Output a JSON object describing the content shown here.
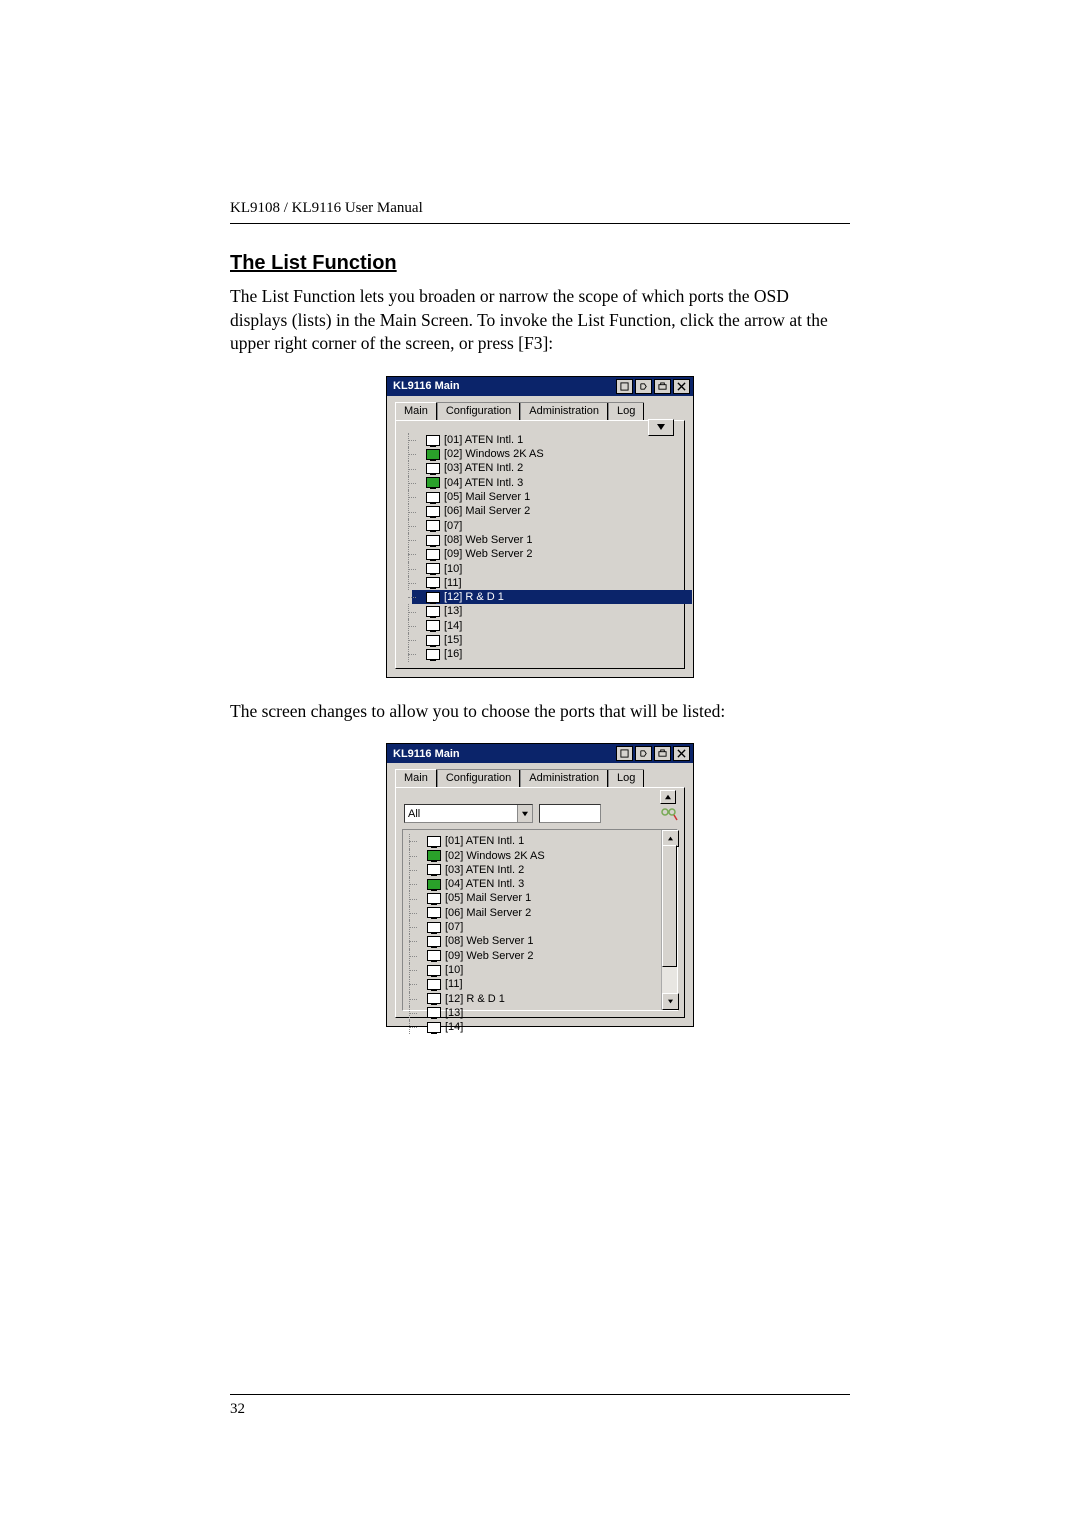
{
  "header": "KL9108 / KL9116 User Manual",
  "section_title": "The List Function",
  "paragraph1": "The List Function lets you broaden or narrow the scope of which ports the OSD displays (lists) in the Main Screen. To invoke the List Function, click the arrow at the upper right corner of the screen, or press [F3]:",
  "paragraph2": "The screen changes to allow you to choose the ports that will be listed:",
  "page_number": "32",
  "osd": {
    "title": "KL9116 Main",
    "tabs": [
      "Main",
      "Configuration",
      "Administration",
      "Log"
    ],
    "ports1": [
      {
        "num": "[01]",
        "name": "ATEN Intl. 1",
        "on": false
      },
      {
        "num": "[02]",
        "name": "Windows 2K AS",
        "on": true
      },
      {
        "num": "[03]",
        "name": "ATEN Intl. 2",
        "on": false
      },
      {
        "num": "[04]",
        "name": "ATEN Intl. 3",
        "on": true
      },
      {
        "num": "[05]",
        "name": "Mail Server 1",
        "on": false
      },
      {
        "num": "[06]",
        "name": "Mail Server 2",
        "on": false
      },
      {
        "num": "[07]",
        "name": "",
        "on": false
      },
      {
        "num": "[08]",
        "name": "Web Server 1",
        "on": false
      },
      {
        "num": "[09]",
        "name": "Web Server 2",
        "on": false
      },
      {
        "num": "[10]",
        "name": "",
        "on": false
      },
      {
        "num": "[11]",
        "name": "",
        "on": false
      },
      {
        "num": "[12]",
        "name": "R & D 1",
        "on": false,
        "selected": true
      },
      {
        "num": "[13]",
        "name": "",
        "on": false
      },
      {
        "num": "[14]",
        "name": "",
        "on": false
      },
      {
        "num": "[15]",
        "name": "",
        "on": false
      },
      {
        "num": "[16]",
        "name": "",
        "on": false
      }
    ],
    "filter_value": "All",
    "ports2": [
      {
        "num": "[01]",
        "name": "ATEN Intl. 1",
        "on": false
      },
      {
        "num": "[02]",
        "name": "Windows 2K AS",
        "on": true
      },
      {
        "num": "[03]",
        "name": "ATEN Intl. 2",
        "on": false
      },
      {
        "num": "[04]",
        "name": "ATEN Intl. 3",
        "on": true
      },
      {
        "num": "[05]",
        "name": "Mail Server 1",
        "on": false
      },
      {
        "num": "[06]",
        "name": "Mail Server 2",
        "on": false
      },
      {
        "num": "[07]",
        "name": "",
        "on": false
      },
      {
        "num": "[08]",
        "name": "Web Server 1",
        "on": false
      },
      {
        "num": "[09]",
        "name": "Web Server 2",
        "on": false
      },
      {
        "num": "[10]",
        "name": "",
        "on": false
      },
      {
        "num": "[11]",
        "name": "",
        "on": false
      },
      {
        "num": "[12]",
        "name": "R & D 1",
        "on": false
      },
      {
        "num": "[13]",
        "name": "",
        "on": false
      },
      {
        "num": "[14]",
        "name": "",
        "on": false
      }
    ]
  }
}
